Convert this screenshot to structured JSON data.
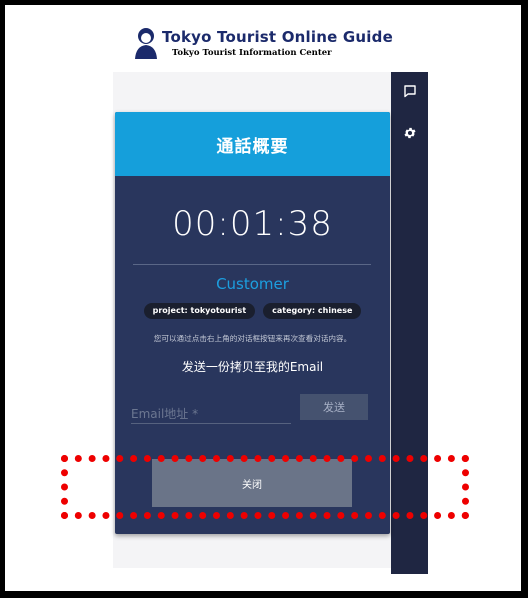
{
  "header": {
    "brand_title": "Tokyo Tourist Online Guide",
    "brand_subtitle": "Tokyo Tourist Information Center"
  },
  "sidebar": {
    "icons": [
      "chat-icon",
      "gear-icon"
    ]
  },
  "dialog": {
    "title": "通話概要",
    "duration": "00:01:38",
    "customer_label": "Customer",
    "tags": [
      {
        "label": "project: tokyotourist"
      },
      {
        "label": "category: chinese"
      }
    ],
    "hint": "您可以通过点击右上角的对话框按钮来再次查看对话内容。",
    "send_copy_label": "发送一份拷贝至我的Email",
    "email_placeholder": "Email地址 *",
    "email_value": "",
    "send_button": "发送",
    "close_button": "关闭"
  },
  "colors": {
    "header_accent": "#159fdb",
    "card_bg": "#29365d",
    "sidebar_bg": "#1f2642",
    "customer_text": "#1c9fe0",
    "highlight": "#ee0000"
  }
}
